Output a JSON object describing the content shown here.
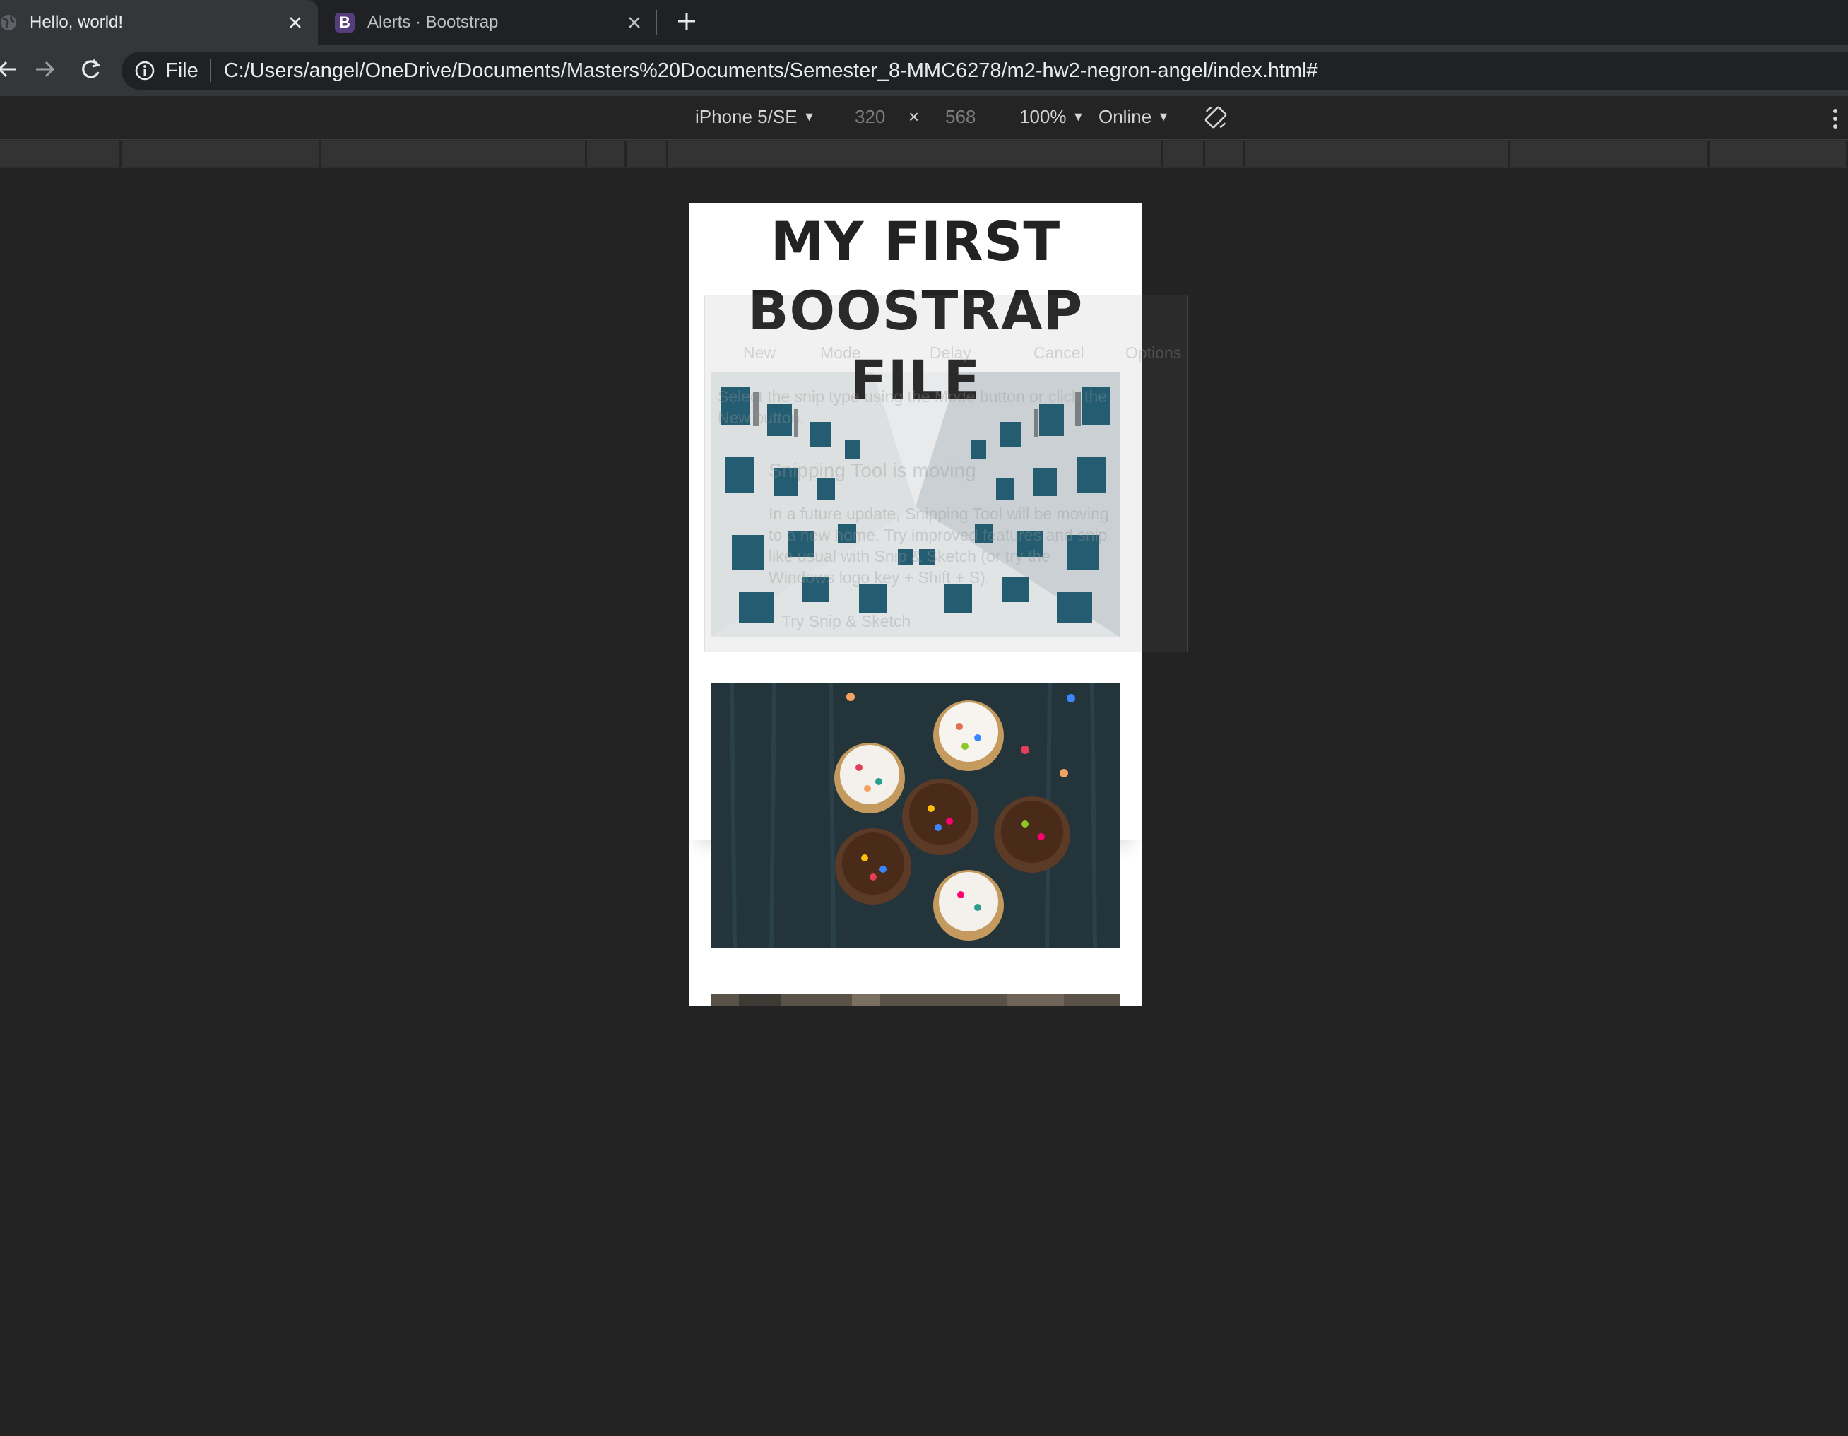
{
  "tabs": [
    {
      "title": "Hello, world!",
      "active": true
    },
    {
      "title": "Alerts · Bootstrap",
      "favicon_letter": "B",
      "active": false
    }
  ],
  "address": {
    "scheme_label": "File",
    "url": "C:/Users/angel/OneDrive/Documents/Masters%20Documents/Semester_8-MMC6278/m2-hw2-negron-angel/index.html#"
  },
  "device_toolbar": {
    "device": "iPhone 5/SE",
    "width": "320",
    "times": "×",
    "height": "568",
    "zoom": "100%",
    "network": "Online"
  },
  "page": {
    "heading": "MY FIRST BOOSTRAP FILE",
    "images": [
      {
        "subject": "looking up between modern white buildings with teal windows"
      },
      {
        "subject": "cupcakes with sprinkles on dark wooden table"
      },
      {
        "subject": "partially visible third photo"
      }
    ]
  },
  "ghost_overlay": {
    "new": "New",
    "mode": "Mode",
    "delay": "Delay",
    "cancel": "Cancel",
    "options": "Options",
    "hint_line1": "Select the snip type using the Mode button or click the",
    "hint_line2": "New button.",
    "notice_title": "Snipping Tool is moving",
    "notice_body1": "In a future update, Snipping Tool will be moving",
    "notice_body2": "to a new home. Try improved features and snip",
    "notice_body3": "like usual with Snip & Sketch (or try the",
    "notice_body4": "Windows logo key + Shift + S).",
    "try_button": "Try Snip & Sketch"
  },
  "colors": {
    "tab_strip": "#202124",
    "toolbar": "#35363a",
    "page_bg": "#232323",
    "bootstrap_purple": "#563d7c"
  }
}
